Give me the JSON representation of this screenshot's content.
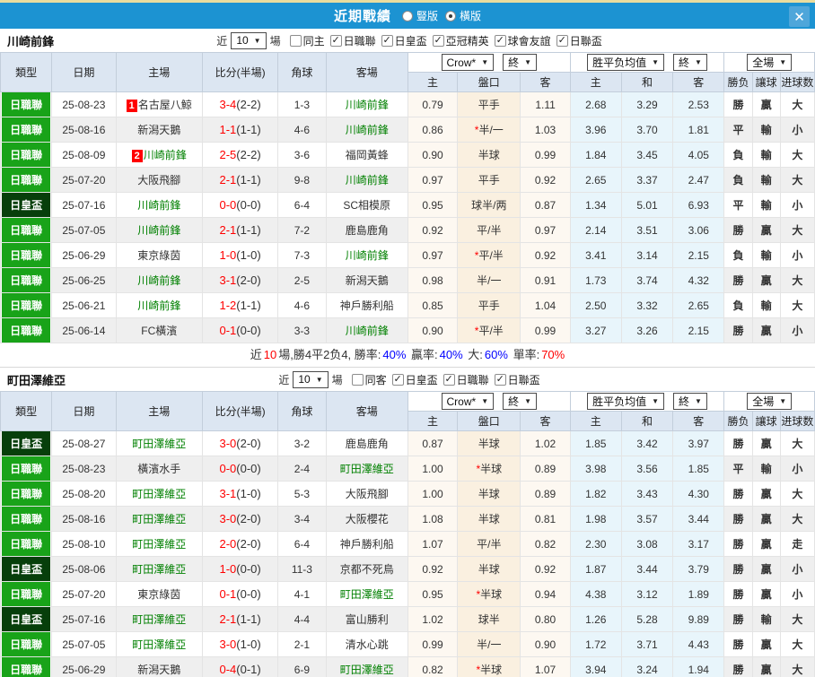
{
  "icons": {
    "chevron_down": "▼",
    "close": "✕",
    "check": "✓"
  },
  "titlebar": {
    "title": "近期戰績",
    "radios": [
      {
        "label": "豎版",
        "checked": false
      },
      {
        "label": "橫版",
        "checked": true
      }
    ]
  },
  "type_colors": {
    "日職聯": "#19a319",
    "日皇盃": "#073f0b"
  },
  "table_headers": {
    "type": "類型",
    "date": "日期",
    "home": "主場",
    "score": "比分(半場)",
    "corners": "角球",
    "away": "客場",
    "odds_group_select": "Crow*",
    "odds_final_select": "終",
    "odds_home": "主",
    "odds_handicap": "盤口",
    "odds_away": "客",
    "avg_group_select": "胜平负均值",
    "avg_final_select": "終",
    "avg_home": "主",
    "avg_draw": "和",
    "avg_away": "客",
    "fullgame_select": "全場",
    "res_wdl": "勝负",
    "res_handicap": "讓球",
    "res_goals": "进球数"
  },
  "sections": [
    {
      "team": "川崎前鋒",
      "filters": {
        "near": "近",
        "count": "10",
        "games": "場",
        "same": {
          "label": "同主",
          "checked": false
        },
        "leagues": [
          {
            "label": "日職聯",
            "checked": true
          },
          {
            "label": "日皇盃",
            "checked": true
          },
          {
            "label": "亞冠精英",
            "checked": true
          },
          {
            "label": "球會友誼",
            "checked": true
          },
          {
            "label": "日聯盃",
            "checked": true
          }
        ]
      },
      "rows": [
        {
          "type": "日職聯",
          "date": "25-08-23",
          "home": {
            "badge": "1",
            "name": "名古屋八鯨",
            "focus": false
          },
          "ft": "3-4",
          "ht": "(2-2)",
          "corners": "1-3",
          "away": {
            "name": "川崎前鋒",
            "focus": true
          },
          "odds": [
            "0.79",
            "平手",
            "1.11"
          ],
          "hstar": false,
          "avg": [
            "2.68",
            "3.29",
            "2.53"
          ],
          "res": [
            [
              "勝",
              "r"
            ],
            [
              "贏",
              "r"
            ],
            [
              "大",
              "r"
            ]
          ]
        },
        {
          "type": "日職聯",
          "date": "25-08-16",
          "home": {
            "badge": null,
            "name": "新潟天鵝",
            "focus": false
          },
          "ft": "1-1",
          "ht": "(1-1)",
          "corners": "4-6",
          "away": {
            "name": "川崎前鋒",
            "focus": true
          },
          "odds": [
            "0.86",
            "半/一",
            "1.03"
          ],
          "hstar": true,
          "avg": [
            "3.96",
            "3.70",
            "1.81"
          ],
          "res": [
            [
              "平",
              "b"
            ],
            [
              "輸",
              "g"
            ],
            [
              "小",
              "g"
            ]
          ]
        },
        {
          "type": "日職聯",
          "date": "25-08-09",
          "home": {
            "badge": "2",
            "name": "川崎前鋒",
            "focus": true
          },
          "ft": "2-5",
          "ht": "(2-2)",
          "corners": "3-6",
          "away": {
            "name": "福岡黃蜂",
            "focus": false
          },
          "odds": [
            "0.90",
            "半球",
            "0.99"
          ],
          "hstar": false,
          "avg": [
            "1.84",
            "3.45",
            "4.05"
          ],
          "res": [
            [
              "負",
              "g"
            ],
            [
              "輸",
              "g"
            ],
            [
              "大",
              "r"
            ]
          ]
        },
        {
          "type": "日職聯",
          "date": "25-07-20",
          "home": {
            "badge": null,
            "name": "大阪飛腳",
            "focus": false
          },
          "ft": "2-1",
          "ht": "(1-1)",
          "corners": "9-8",
          "away": {
            "name": "川崎前鋒",
            "focus": true
          },
          "odds": [
            "0.97",
            "平手",
            "0.92"
          ],
          "hstar": false,
          "avg": [
            "2.65",
            "3.37",
            "2.47"
          ],
          "res": [
            [
              "負",
              "g"
            ],
            [
              "輸",
              "g"
            ],
            [
              "大",
              "r"
            ]
          ]
        },
        {
          "type": "日皇盃",
          "date": "25-07-16",
          "home": {
            "badge": null,
            "name": "川崎前鋒",
            "focus": true
          },
          "ft": "0-0",
          "ht": "(0-0)",
          "corners": "6-4",
          "away": {
            "name": "SC相模原",
            "focus": false
          },
          "odds": [
            "0.95",
            "球半/两",
            "0.87"
          ],
          "hstar": false,
          "avg": [
            "1.34",
            "5.01",
            "6.93"
          ],
          "res": [
            [
              "平",
              "b"
            ],
            [
              "輸",
              "g"
            ],
            [
              "小",
              "g"
            ]
          ]
        },
        {
          "type": "日職聯",
          "date": "25-07-05",
          "home": {
            "badge": null,
            "name": "川崎前鋒",
            "focus": true
          },
          "ft": "2-1",
          "ht": "(1-1)",
          "corners": "7-2",
          "away": {
            "name": "鹿島鹿角",
            "focus": false
          },
          "odds": [
            "0.92",
            "平/半",
            "0.97"
          ],
          "hstar": false,
          "avg": [
            "2.14",
            "3.51",
            "3.06"
          ],
          "res": [
            [
              "勝",
              "r"
            ],
            [
              "贏",
              "r"
            ],
            [
              "大",
              "r"
            ]
          ]
        },
        {
          "type": "日職聯",
          "date": "25-06-29",
          "home": {
            "badge": null,
            "name": "東京綠茵",
            "focus": false
          },
          "ft": "1-0",
          "ht": "(1-0)",
          "corners": "7-3",
          "away": {
            "name": "川崎前鋒",
            "focus": true
          },
          "odds": [
            "0.97",
            "平/半",
            "0.92"
          ],
          "hstar": true,
          "avg": [
            "3.41",
            "3.14",
            "2.15"
          ],
          "res": [
            [
              "負",
              "g"
            ],
            [
              "輸",
              "g"
            ],
            [
              "小",
              "g"
            ]
          ]
        },
        {
          "type": "日職聯",
          "date": "25-06-25",
          "home": {
            "badge": null,
            "name": "川崎前鋒",
            "focus": true
          },
          "ft": "3-1",
          "ht": "(2-0)",
          "corners": "2-5",
          "away": {
            "name": "新潟天鵝",
            "focus": false
          },
          "odds": [
            "0.98",
            "半/一",
            "0.91"
          ],
          "hstar": false,
          "avg": [
            "1.73",
            "3.74",
            "4.32"
          ],
          "res": [
            [
              "勝",
              "r"
            ],
            [
              "贏",
              "r"
            ],
            [
              "大",
              "r"
            ]
          ]
        },
        {
          "type": "日職聯",
          "date": "25-06-21",
          "home": {
            "badge": null,
            "name": "川崎前鋒",
            "focus": true
          },
          "ft": "1-2",
          "ht": "(1-1)",
          "corners": "4-6",
          "away": {
            "name": "神戶勝利船",
            "focus": false
          },
          "odds": [
            "0.85",
            "平手",
            "1.04"
          ],
          "hstar": false,
          "avg": [
            "2.50",
            "3.32",
            "2.65"
          ],
          "res": [
            [
              "負",
              "g"
            ],
            [
              "輸",
              "g"
            ],
            [
              "大",
              "r"
            ]
          ]
        },
        {
          "type": "日職聯",
          "date": "25-06-14",
          "home": {
            "badge": null,
            "name": "FC橫濱",
            "focus": false
          },
          "ft": "0-1",
          "ht": "(0-0)",
          "corners": "3-3",
          "away": {
            "name": "川崎前鋒",
            "focus": true
          },
          "odds": [
            "0.90",
            "平/半",
            "0.99"
          ],
          "hstar": true,
          "avg": [
            "3.27",
            "3.26",
            "2.15"
          ],
          "res": [
            [
              "勝",
              "r"
            ],
            [
              "贏",
              "r"
            ],
            [
              "小",
              "g"
            ]
          ]
        }
      ],
      "summary": [
        {
          "text": "近",
          "c": "k"
        },
        {
          "text": "10",
          "c": "r"
        },
        {
          "text": "場,勝4平2负4, 勝率:",
          "c": "k"
        },
        {
          "text": "40%",
          "c": "bb"
        },
        {
          "text": " 贏率:",
          "c": "k"
        },
        {
          "text": "40%",
          "c": "bb"
        },
        {
          "text": " 大:",
          "c": "k"
        },
        {
          "text": "60%",
          "c": "bb"
        },
        {
          "text": " 單率:",
          "c": "k"
        },
        {
          "text": "70%",
          "c": "r"
        }
      ]
    },
    {
      "team": "町田澤維亞",
      "filters": {
        "near": "近",
        "count": "10",
        "games": "場",
        "same": {
          "label": "同客",
          "checked": false
        },
        "leagues": [
          {
            "label": "日皇盃",
            "checked": true
          },
          {
            "label": "日職聯",
            "checked": true
          },
          {
            "label": "日聯盃",
            "checked": true
          }
        ]
      },
      "rows": [
        {
          "type": "日皇盃",
          "date": "25-08-27",
          "home": {
            "badge": null,
            "name": "町田澤維亞",
            "focus": true
          },
          "ft": "3-0",
          "ht": "(2-0)",
          "corners": "3-2",
          "away": {
            "name": "鹿島鹿角",
            "focus": false
          },
          "odds": [
            "0.87",
            "半球",
            "1.02"
          ],
          "hstar": false,
          "avg": [
            "1.85",
            "3.42",
            "3.97"
          ],
          "res": [
            [
              "勝",
              "r"
            ],
            [
              "贏",
              "r"
            ],
            [
              "大",
              "r"
            ]
          ]
        },
        {
          "type": "日職聯",
          "date": "25-08-23",
          "home": {
            "badge": null,
            "name": "橫濱水手",
            "focus": false
          },
          "ft": "0-0",
          "ht": "(0-0)",
          "corners": "2-4",
          "away": {
            "name": "町田澤維亞",
            "focus": true
          },
          "odds": [
            "1.00",
            "半球",
            "0.89"
          ],
          "hstar": true,
          "avg": [
            "3.98",
            "3.56",
            "1.85"
          ],
          "res": [
            [
              "平",
              "b"
            ],
            [
              "輸",
              "g"
            ],
            [
              "小",
              "g"
            ]
          ]
        },
        {
          "type": "日職聯",
          "date": "25-08-20",
          "home": {
            "badge": null,
            "name": "町田澤維亞",
            "focus": true
          },
          "ft": "3-1",
          "ht": "(1-0)",
          "corners": "5-3",
          "away": {
            "name": "大阪飛腳",
            "focus": false
          },
          "odds": [
            "1.00",
            "半球",
            "0.89"
          ],
          "hstar": false,
          "avg": [
            "1.82",
            "3.43",
            "4.30"
          ],
          "res": [
            [
              "勝",
              "r"
            ],
            [
              "贏",
              "r"
            ],
            [
              "大",
              "r"
            ]
          ]
        },
        {
          "type": "日職聯",
          "date": "25-08-16",
          "home": {
            "badge": null,
            "name": "町田澤維亞",
            "focus": true
          },
          "ft": "3-0",
          "ht": "(2-0)",
          "corners": "3-4",
          "away": {
            "name": "大阪櫻花",
            "focus": false
          },
          "odds": [
            "1.08",
            "半球",
            "0.81"
          ],
          "hstar": false,
          "avg": [
            "1.98",
            "3.57",
            "3.44"
          ],
          "res": [
            [
              "勝",
              "r"
            ],
            [
              "贏",
              "r"
            ],
            [
              "大",
              "r"
            ]
          ]
        },
        {
          "type": "日職聯",
          "date": "25-08-10",
          "home": {
            "badge": null,
            "name": "町田澤維亞",
            "focus": true
          },
          "ft": "2-0",
          "ht": "(2-0)",
          "corners": "6-4",
          "away": {
            "name": "神戶勝利船",
            "focus": false
          },
          "odds": [
            "1.07",
            "平/半",
            "0.82"
          ],
          "hstar": false,
          "avg": [
            "2.30",
            "3.08",
            "3.17"
          ],
          "res": [
            [
              "勝",
              "r"
            ],
            [
              "贏",
              "r"
            ],
            [
              "走",
              "b"
            ]
          ]
        },
        {
          "type": "日皇盃",
          "date": "25-08-06",
          "home": {
            "badge": null,
            "name": "町田澤維亞",
            "focus": true
          },
          "ft": "1-0",
          "ht": "(0-0)",
          "corners": "11-3",
          "away": {
            "name": "京都不死鳥",
            "focus": false
          },
          "odds": [
            "0.92",
            "半球",
            "0.92"
          ],
          "hstar": false,
          "avg": [
            "1.87",
            "3.44",
            "3.79"
          ],
          "res": [
            [
              "勝",
              "r"
            ],
            [
              "贏",
              "r"
            ],
            [
              "小",
              "g"
            ]
          ]
        },
        {
          "type": "日職聯",
          "date": "25-07-20",
          "home": {
            "badge": null,
            "name": "東京綠茵",
            "focus": false
          },
          "ft": "0-1",
          "ht": "(0-0)",
          "corners": "4-1",
          "away": {
            "name": "町田澤維亞",
            "focus": true
          },
          "odds": [
            "0.95",
            "半球",
            "0.94"
          ],
          "hstar": true,
          "avg": [
            "4.38",
            "3.12",
            "1.89"
          ],
          "res": [
            [
              "勝",
              "r"
            ],
            [
              "贏",
              "r"
            ],
            [
              "小",
              "g"
            ]
          ]
        },
        {
          "type": "日皇盃",
          "date": "25-07-16",
          "home": {
            "badge": null,
            "name": "町田澤維亞",
            "focus": true
          },
          "ft": "2-1",
          "ht": "(1-1)",
          "corners": "4-4",
          "away": {
            "name": "富山勝利",
            "focus": false
          },
          "odds": [
            "1.02",
            "球半",
            "0.80"
          ],
          "hstar": false,
          "avg": [
            "1.26",
            "5.28",
            "9.89"
          ],
          "res": [
            [
              "勝",
              "r"
            ],
            [
              "輸",
              "g"
            ],
            [
              "大",
              "r"
            ]
          ]
        },
        {
          "type": "日職聯",
          "date": "25-07-05",
          "home": {
            "badge": null,
            "name": "町田澤維亞",
            "focus": true
          },
          "ft": "3-0",
          "ht": "(1-0)",
          "corners": "2-1",
          "away": {
            "name": "清水心跳",
            "focus": false
          },
          "odds": [
            "0.99",
            "半/一",
            "0.90"
          ],
          "hstar": false,
          "avg": [
            "1.72",
            "3.71",
            "4.43"
          ],
          "res": [
            [
              "勝",
              "r"
            ],
            [
              "贏",
              "r"
            ],
            [
              "大",
              "r"
            ]
          ]
        },
        {
          "type": "日職聯",
          "date": "25-06-29",
          "home": {
            "badge": null,
            "name": "新潟天鵝",
            "focus": false
          },
          "ft": "0-4",
          "ht": "(0-1)",
          "corners": "6-9",
          "away": {
            "name": "町田澤維亞",
            "focus": true
          },
          "odds": [
            "0.82",
            "半球",
            "1.07"
          ],
          "hstar": true,
          "avg": [
            "3.94",
            "3.24",
            "1.94"
          ],
          "res": [
            [
              "勝",
              "r"
            ],
            [
              "贏",
              "r"
            ],
            [
              "大",
              "r"
            ]
          ]
        }
      ],
      "summary": null
    }
  ]
}
